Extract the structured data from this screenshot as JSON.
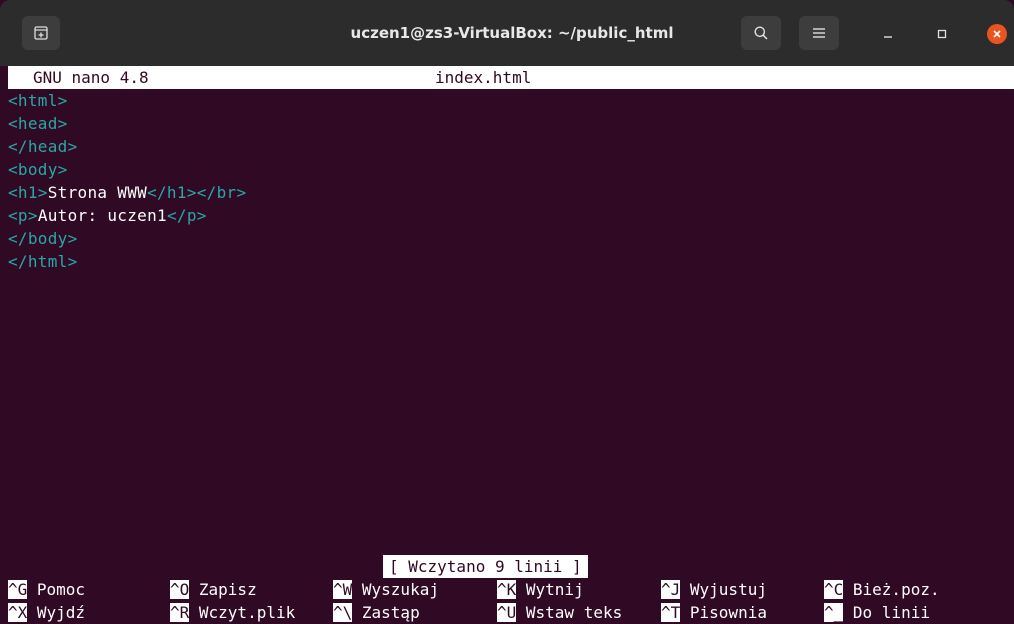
{
  "window": {
    "title": "uczen1@zs3-VirtualBox: ~/public_html",
    "icons": {
      "new_tab": "new-tab-icon",
      "search": "search-icon",
      "menu": "hamburger-menu-icon",
      "minimize": "minimize-icon",
      "maximize": "maximize-icon",
      "close": "close-icon"
    },
    "colors": {
      "titlebar": "#2c2c2c",
      "close": "#e95420",
      "terminal_bg": "#300a24",
      "tag": "#2aa6a8"
    }
  },
  "nano": {
    "version": "GNU nano 4.8",
    "filename": "index.html",
    "lines": [
      [
        {
          "t": "tag",
          "v": "<html>"
        }
      ],
      [
        {
          "t": "tag",
          "v": "<head>"
        }
      ],
      [
        {
          "t": "tag",
          "v": "</head>"
        }
      ],
      [
        {
          "t": "tag",
          "v": "<body>"
        }
      ],
      [
        {
          "t": "tag",
          "v": "<h1>"
        },
        {
          "t": "txt",
          "v": "Strona WWW"
        },
        {
          "t": "tag",
          "v": "</h1></br>"
        }
      ],
      [
        {
          "t": "tag",
          "v": "<p>"
        },
        {
          "t": "txt",
          "v": "Autor: uczen1"
        },
        {
          "t": "tag",
          "v": "</p>"
        }
      ],
      [
        {
          "t": "tag",
          "v": "</body>"
        }
      ],
      [
        {
          "t": "tag",
          "v": "</html>"
        }
      ]
    ],
    "status": "[ Wczytano 9 linii ]",
    "shortcuts_row1": [
      {
        "key": "^G",
        "label": "Pomoc"
      },
      {
        "key": "^O",
        "label": "Zapisz"
      },
      {
        "key": "^W",
        "label": "Wyszukaj"
      },
      {
        "key": "^K",
        "label": "Wytnij"
      },
      {
        "key": "^J",
        "label": "Wyjustuj"
      },
      {
        "key": "^C",
        "label": "Bież.poz."
      }
    ],
    "shortcuts_row2": [
      {
        "key": "^X",
        "label": "Wyjdź"
      },
      {
        "key": "^R",
        "label": "Wczyt.plik"
      },
      {
        "key": "^\\",
        "label": "Zastąp"
      },
      {
        "key": "^U",
        "label": "Wstaw teks"
      },
      {
        "key": "^T",
        "label": "Pisownia"
      },
      {
        "key": "^_",
        "label": "Do linii"
      }
    ]
  }
}
